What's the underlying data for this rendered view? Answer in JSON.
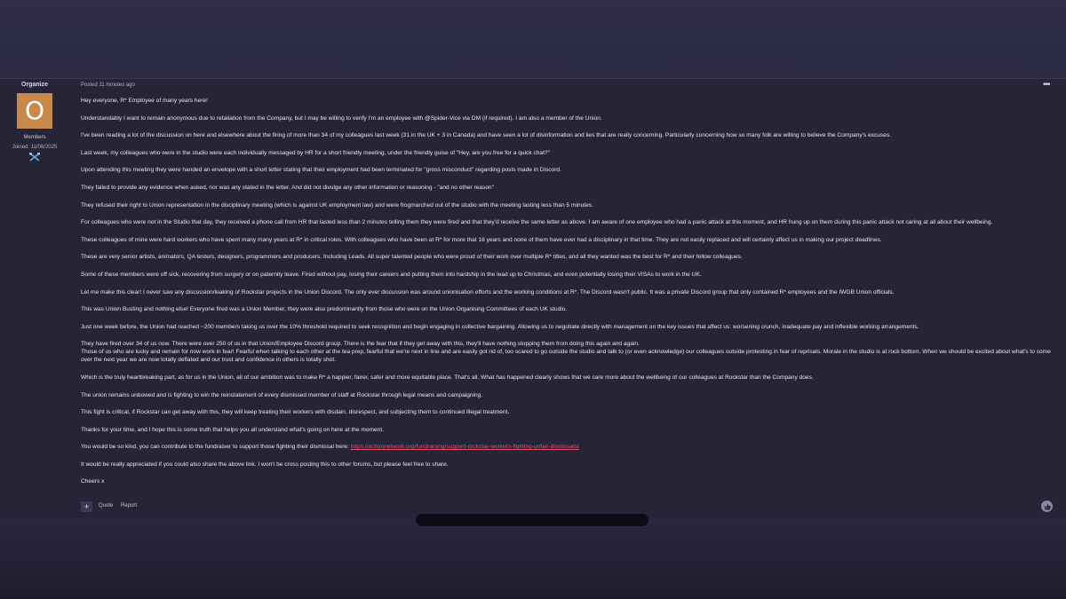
{
  "author": {
    "name": "Organize",
    "avatar_letter": "O",
    "group": "Members",
    "joined": "Joined: 11/06/2025",
    "badge_icon": "crossed-tools-badge-icon"
  },
  "post": {
    "meta": "Posted 11 minutes ago",
    "paragraphs": [
      "Hey everyone, R* Employee of many years here!",
      "Understandably I want to remain anonymous due to retaliation from the Company, but I may be willing to verify I'm an employee with @Spider-Vice via DM (if required). I am also a member of the Union.",
      "I've been reading a lot of the discussion on here and elsewhere about the firing of more than 34 of my colleagues last week (31 in the UK + 3 in Canada) and have seen a lot of disinformation and lies that are really concerning. Particularly concerning how so many folk are willing to believe the Company's excuses.",
      "Last week, my colleagues who were in the studio were each individually messaged by HR for a short friendly meeting, under the friendly guise of \"Hey, are you free for a quick chat?\"",
      "Upon attending this meeting they were handed an envelope with a short letter stating that their employment had been terminated for \"gross misconduct\" regarding posts made in Discord.",
      "They failed to provide any evidence when asked, nor was any stated in the letter. And did not divulge any other information or reasoning - \"and no other reason\"",
      "They refused their right to Union representation in the disciplinary meeting (which is against UK employment law) and were frogmarched out of the studio with the meeting lasting less than 5 minutes.",
      "For colleagues who were not in the Studio that day, they received a phone call from HR that lasted less than 2 minutes telling them they were fired and that they'd receive the same letter as above. I am aware of one employee who had a panic attack at this moment, and HR hung up on them during this panic attack not caring at all about their wellbeing.",
      "These colleagues of mine were hard workers who have spent many many years at R* in critical roles. With colleagues who have been at R* for more that 18 years and none of them have ever had a disciplinary in that time. They are not easily replaced and will certainly affect us in making our project deadlines.",
      "These are very senior artists, animators, QA testers, designers, programmers and producers. Including Leads. All super talented people who were proud of their work over multiple R* titles, and all they wanted was the best for R* and their fellow colleagues.",
      "Some of these members were off sick, recovering from surgery or on paternity leave. Fired without pay, losing their careers and putting them into hardship in the lead up to Christmas, and even potentially losing their VISAs to work in the UK.",
      "Let me make this clear! I never saw any discussion/leaking of Rockstar projects in the Union Discord. The only ever discussion was around unionisation efforts and the working conditions at R*. The Discord wasn't public. It was a private Discord group that only contained R* employees and the IWGB Union officials.",
      "This was Union Busting and nothing else! Everyone fired was a Union Member, they were also predominantly from those who were on the Union Organising Committees of each UK studio.",
      "Just one week before, the Union had reached ~200 members taking us over the 10% threshold required to seek recognition and begin engaging in collective bargaining. Allowing us to negotiate directly with management on the key issues that affect us: worsening crunch, inadequate pay and inflexible working arrangements.",
      "They have fired over 34 of us now. There were over 250 of us in that Union/Employee Discord group. There is the fear that if they get away with this, they'll have nothing stopping them from doing this again and again.\nThose of us who are lucky and remain for now work in fear! Fearful when talking to each other at the tea prep, fearful that we're next in line and are easily got rid of, too scared to go outside the studio and talk to (or even acknowledge) our colleagues outside protesting in fear of reprisals. Morale in the studio is at rock bottom. When we should be excited about what's to come over the next year we are now totally deflated and our trust and confidence in others is totally shot.",
      "Which is the truly heartbreaking part, as for us in the Union, all of our ambition was to make R* a happier, fairer, safer and more equitable place. That's all. What has happened clearly shows that we care more about the wellbeing of our colleagues at Rockstar than the Company does.",
      "The union remains unbowed and is fighting to win the reinstatement of every dismissed member of staff at Rockstar through legal means and campaigning.",
      "This fight is critical, if Rockstar can get away with this, they will keep treating their workers with disdain, disrespect, and subjecting them to continued illegal treatment.",
      "Thanks for your time, and I hope this is some truth that helps you all understand what's going on here at the moment."
    ],
    "fundraiser_text": "You would be so kind, you can contribute to the fundraiser to support those fighting their dismissal here: ",
    "fundraiser_link": "https://actionnetwork.org/fundraising/support-rockstar-workers-fighting-unfair-dismissals/",
    "share_text": "It would be really appreciated if you could also share the above link. I won't be cross posting this to other forums, but please feel free to share.",
    "signoff": "Cheers x"
  },
  "actions": {
    "add_label": "+",
    "quote_label": "Quote",
    "report_label": "Report",
    "more_label": "•••",
    "react_icon": "thumbs-up-icon"
  },
  "colors": {
    "avatar_bg": "#c8894a",
    "link": "#e2526c",
    "card_bg": "#262437"
  }
}
